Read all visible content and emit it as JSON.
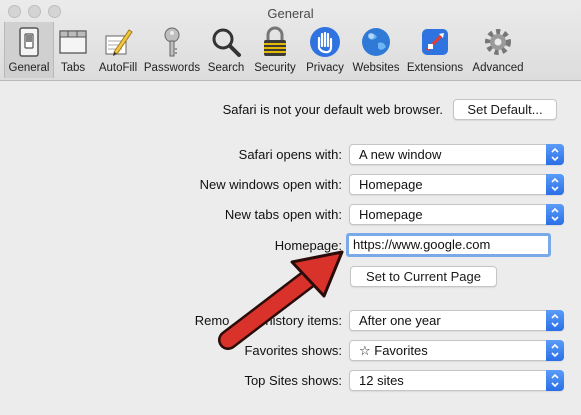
{
  "window": {
    "title": "General"
  },
  "toolbar": {
    "tabs": [
      {
        "label": "General",
        "icon": "switch-icon"
      },
      {
        "label": "Tabs",
        "icon": "tabs-icon"
      },
      {
        "label": "AutoFill",
        "icon": "pencil-icon"
      },
      {
        "label": "Passwords",
        "icon": "key-icon"
      },
      {
        "label": "Search",
        "icon": "magnifier-icon"
      },
      {
        "label": "Security",
        "icon": "padlock-icon"
      },
      {
        "label": "Privacy",
        "icon": "hand-icon"
      },
      {
        "label": "Websites",
        "icon": "globe-icon"
      },
      {
        "label": "Extensions",
        "icon": "puzzle-icon"
      },
      {
        "label": "Advanced",
        "icon": "gear-icon"
      }
    ]
  },
  "default_browser": {
    "message": "Safari is not your default web browser.",
    "button": "Set Default..."
  },
  "settings": {
    "opens_with": {
      "label": "Safari opens with:",
      "value": "A new window"
    },
    "new_windows": {
      "label": "New windows open with:",
      "value": "Homepage"
    },
    "new_tabs": {
      "label": "New tabs open with:",
      "value": "Homepage"
    },
    "homepage": {
      "label": "Homepage:",
      "value": "https://www.google.com"
    },
    "set_current": "Set to Current Page",
    "remove_history": {
      "label": "Remove history items:",
      "label_visible": "Remo",
      "label_visible_end": "history items:",
      "value": "After one year"
    },
    "favorites": {
      "label": "Favorites shows:",
      "value": "☆ Favorites"
    },
    "top_sites": {
      "label": "Top Sites shows:",
      "value": "12 sites"
    }
  },
  "colors": {
    "accent": "#2a6fe6",
    "arrow": "#d9322a",
    "focus_ring": "#7aa9ea"
  }
}
